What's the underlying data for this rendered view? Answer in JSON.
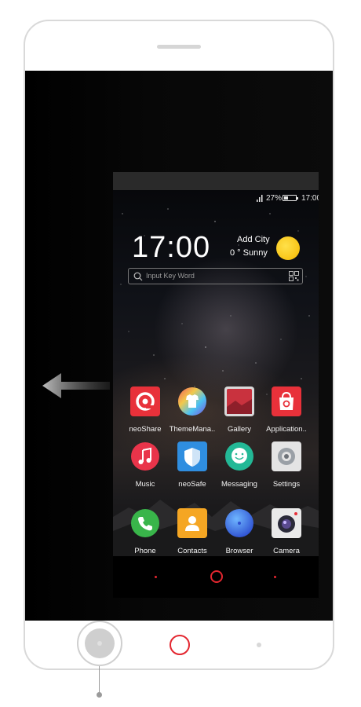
{
  "status_bar": {
    "battery_percent": "27%",
    "time": "17:00"
  },
  "clock_widget": {
    "time": "17:00",
    "weather_city": "Add City",
    "weather_temp": "0 °",
    "weather_condition": "Sunny",
    "search_placeholder": "Input Key Word"
  },
  "apps": [
    {
      "label": "neoShare",
      "icon": "neoshare-icon",
      "color": "#e8313a"
    },
    {
      "label": "ThemeMana..",
      "icon": "theme-manager-icon",
      "color": "#7c4ddb"
    },
    {
      "label": "Gallery",
      "icon": "gallery-icon",
      "color": "#c9323e"
    },
    {
      "label": "Application..",
      "icon": "app-store-icon",
      "color": "#e8313a"
    },
    {
      "label": "Music",
      "icon": "music-icon",
      "color": "#e9344a"
    },
    {
      "label": "neoSafe",
      "icon": "shield-icon",
      "color": "#2f8ee0"
    },
    {
      "label": "Messaging",
      "icon": "messaging-icon",
      "color": "#23b896"
    },
    {
      "label": "Settings",
      "icon": "settings-icon",
      "color": "#9aa0a6"
    }
  ],
  "dock": [
    {
      "label": "Phone",
      "icon": "phone-icon",
      "color": "#39b54a"
    },
    {
      "label": "Contacts",
      "icon": "contacts-icon",
      "color": "#f5a623"
    },
    {
      "label": "Browser",
      "icon": "browser-icon",
      "color": "#2d6fe0"
    },
    {
      "label": "Camera",
      "icon": "camera-icon",
      "color": "#e8e8e8"
    }
  ],
  "colors": {
    "accent_red": "#e3262f",
    "bezel": "#d9d9d9"
  },
  "gesture": {
    "direction": "left",
    "hardware_button_pressed": "left-key"
  }
}
